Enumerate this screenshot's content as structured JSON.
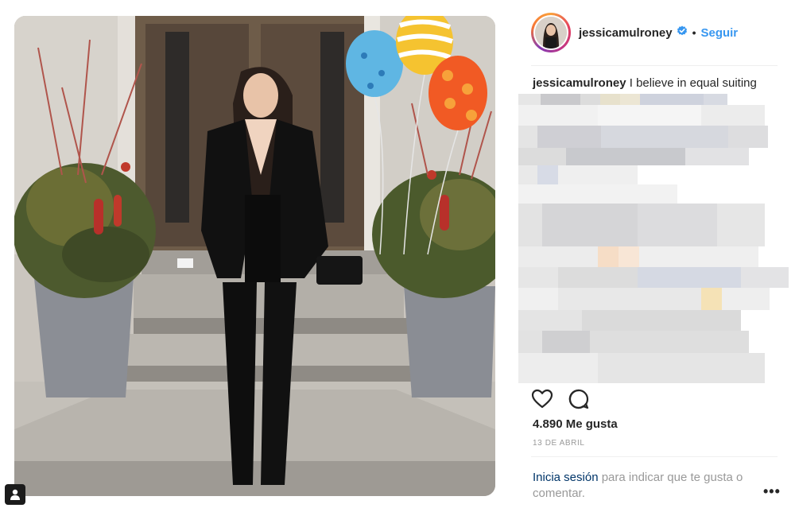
{
  "post": {
    "username": "jessicamulroney",
    "follow_label": "Seguir",
    "separator": "•",
    "caption_text": "I believe in equal suiting",
    "likes": "4.890 Me gusta",
    "date": "13 DE ABRIL",
    "login_link": "Inicia sesión",
    "login_rest": "para indicar que te gusta o comentar.",
    "more_label": "•••"
  },
  "icons": {
    "verified": "verified-badge-icon",
    "like": "heart-icon",
    "comment": "comment-icon",
    "user_tag": "person-icon"
  },
  "colors": {
    "link_blue": "#3897f0",
    "login_blue": "#003569",
    "text": "#262626",
    "muted": "#999999",
    "avatar_ring": "#e4405f"
  }
}
